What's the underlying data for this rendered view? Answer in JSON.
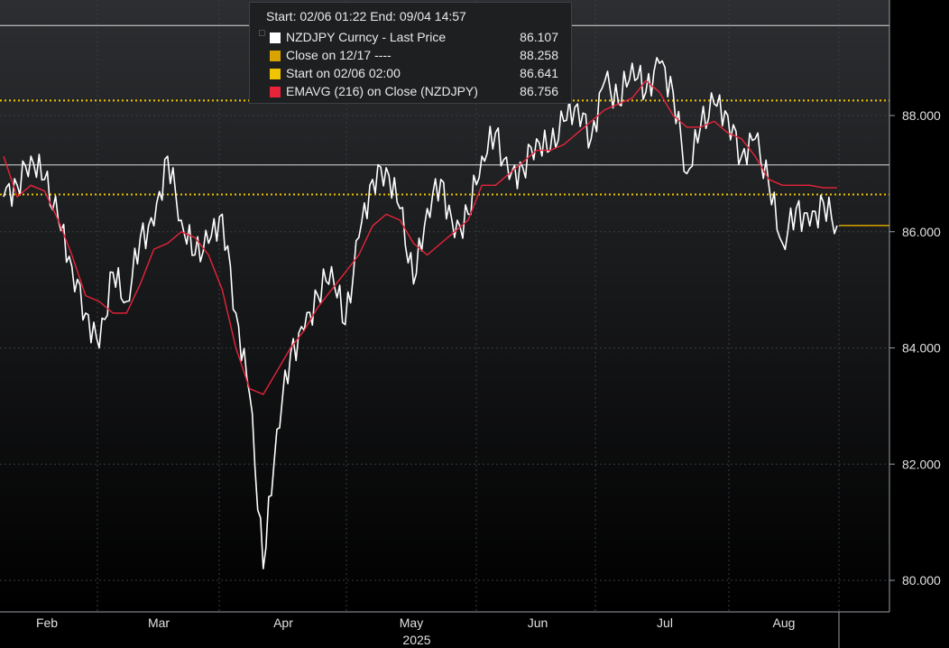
{
  "header": {
    "range_text": "Start: 02/06 01:22 End: 09/04 14:57"
  },
  "legend": [
    {
      "label": "NZDJPY Curncy - Last Price",
      "value": "86.107",
      "color": "#ffffff",
      "tree": "□"
    },
    {
      "label": "Close on 12/17 ----",
      "value": "88.258",
      "color": "#d9a400",
      "tree": ""
    },
    {
      "label": "Start on 02/06 02:00",
      "value": "86.641",
      "color": "#f0c400",
      "tree": ""
    },
    {
      "label": "EMAVG (216)  on Close (NZDJPY)",
      "value": "86.756",
      "color": "#e8243a",
      "tree": ""
    }
  ],
  "colors": {
    "background": "#000000",
    "price": "#ffffff",
    "ema": "#e8243a",
    "reference_line": "#f0c400",
    "last_price_marker": "#d9a400",
    "grid": "#3a3c40"
  },
  "chart_data": {
    "type": "line",
    "ylim": [
      79.5,
      89.7
    ],
    "yticks": [
      "80.000",
      "82.000",
      "84.000",
      "86.000",
      "88.000"
    ],
    "x_months": [
      "Feb",
      "Mar",
      "Apr",
      "May",
      "Jun",
      "Jul",
      "Aug"
    ],
    "x_year": "2025",
    "reference_lines": [
      {
        "label": "Close on 12/17",
        "value": 88.258,
        "style": "dotted"
      },
      {
        "label": "Start on 02/06 02:00",
        "value": 86.641,
        "style": "dotted"
      }
    ],
    "horizontal_lines": [
      89.55,
      87.15
    ],
    "last_price": 86.107,
    "series": [
      {
        "name": "NZDJPY Curncy - Last Price",
        "x": [
          "02/06",
          "02/10",
          "02/13",
          "02/17",
          "02/20",
          "02/24",
          "02/27",
          "03/03",
          "03/06",
          "03/10",
          "03/13",
          "03/17",
          "03/20",
          "03/24",
          "03/27",
          "03/31",
          "04/03",
          "04/06",
          "04/08",
          "04/10",
          "04/14",
          "04/17",
          "04/21",
          "04/24",
          "04/28",
          "05/01",
          "05/05",
          "05/08",
          "05/12",
          "05/15",
          "05/19",
          "05/22",
          "05/26",
          "05/29",
          "06/02",
          "06/05",
          "06/09",
          "06/12",
          "06/16",
          "06/19",
          "06/23",
          "06/26",
          "06/30",
          "07/03",
          "07/07",
          "07/10",
          "07/14",
          "07/17",
          "07/21",
          "07/24",
          "07/28",
          "07/31",
          "08/04",
          "08/07",
          "08/11",
          "08/14",
          "08/18",
          "08/21",
          "08/25",
          "08/28",
          "09/01",
          "09/04"
        ],
        "values": [
          86.6,
          86.8,
          87.3,
          86.9,
          86.2,
          85.4,
          84.6,
          84.0,
          85.3,
          84.8,
          85.9,
          86.1,
          87.3,
          86.2,
          85.6,
          85.8,
          86.3,
          84.6,
          83.2,
          80.2,
          82.6,
          83.9,
          84.3,
          84.9,
          85.4,
          84.4,
          85.9,
          86.9,
          87.1,
          86.4,
          85.1,
          86.4,
          86.9,
          85.9,
          86.3,
          87.3,
          87.7,
          86.9,
          87.1,
          87.6,
          87.4,
          87.9,
          88.2,
          87.6,
          88.6,
          88.2,
          88.9,
          88.4,
          88.9,
          88.4,
          87.0,
          87.8,
          88.2,
          88.0,
          87.3,
          87.6,
          86.8,
          85.8,
          86.4,
          86.1,
          86.5,
          86.107
        ]
      },
      {
        "name": "EMAVG (216)  on Close (NZDJPY)",
        "x": [
          "02/06",
          "02/10",
          "02/13",
          "02/17",
          "02/20",
          "02/24",
          "02/27",
          "03/03",
          "03/06",
          "03/10",
          "03/13",
          "03/17",
          "03/20",
          "03/24",
          "03/27",
          "03/31",
          "04/03",
          "04/06",
          "04/08",
          "04/10",
          "04/14",
          "04/17",
          "04/21",
          "04/24",
          "04/28",
          "05/01",
          "05/05",
          "05/08",
          "05/12",
          "05/15",
          "05/19",
          "05/22",
          "05/26",
          "05/29",
          "06/02",
          "06/05",
          "06/09",
          "06/12",
          "06/16",
          "06/19",
          "06/23",
          "06/26",
          "06/30",
          "07/03",
          "07/07",
          "07/10",
          "07/14",
          "07/17",
          "07/21",
          "07/24",
          "07/28",
          "07/31",
          "08/04",
          "08/07",
          "08/11",
          "08/14",
          "08/18",
          "08/21",
          "08/25",
          "08/28",
          "09/01",
          "09/04"
        ],
        "values": [
          87.3,
          86.6,
          86.8,
          86.7,
          86.2,
          85.6,
          84.9,
          84.8,
          84.6,
          84.6,
          85.1,
          85.7,
          85.8,
          86.0,
          85.9,
          85.6,
          85.0,
          84.0,
          83.3,
          83.2,
          83.6,
          84.0,
          84.3,
          84.7,
          85.0,
          85.3,
          85.6,
          86.1,
          86.3,
          86.2,
          85.8,
          85.6,
          85.8,
          86.0,
          86.2,
          86.8,
          86.8,
          87.0,
          87.2,
          87.4,
          87.4,
          87.5,
          87.7,
          87.9,
          88.1,
          88.2,
          88.3,
          88.6,
          88.4,
          88.0,
          87.8,
          87.8,
          87.9,
          87.7,
          87.6,
          87.3,
          86.9,
          86.8,
          86.8,
          86.8,
          86.756,
          86.756
        ]
      }
    ]
  }
}
